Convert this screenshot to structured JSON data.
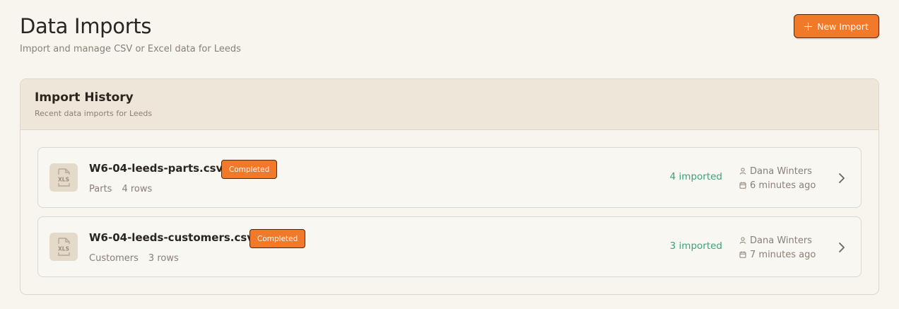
{
  "header": {
    "title": "Data Imports",
    "subtitle": "Import and manage CSV or Excel data for Leeds",
    "new_import_label": "New Import"
  },
  "history": {
    "title": "Import History",
    "subtitle": "Recent data imports for Leeds",
    "items": [
      {
        "file_name": "W6-04-leeds-parts.csv",
        "status": "Completed",
        "type": "Parts",
        "rows": "4 rows",
        "imported": "4 imported",
        "user": "Dana Winters",
        "time": "6 minutes ago",
        "icon_text": "XLS"
      },
      {
        "file_name": "W6-04-leeds-customers.csv",
        "status": "Completed",
        "type": "Customers",
        "rows": "3 rows",
        "imported": "3 imported",
        "user": "Dana Winters",
        "time": "7 minutes ago",
        "icon_text": "XLS"
      }
    ]
  },
  "colors": {
    "accent": "#f07a2a",
    "success": "#3aa37a",
    "background": "#f8f5ef"
  },
  "icons": {
    "file": "xls-file-icon",
    "user": "user-icon",
    "calendar": "calendar-icon",
    "chevron": "chevron-right-icon",
    "plus": "plus-icon"
  }
}
